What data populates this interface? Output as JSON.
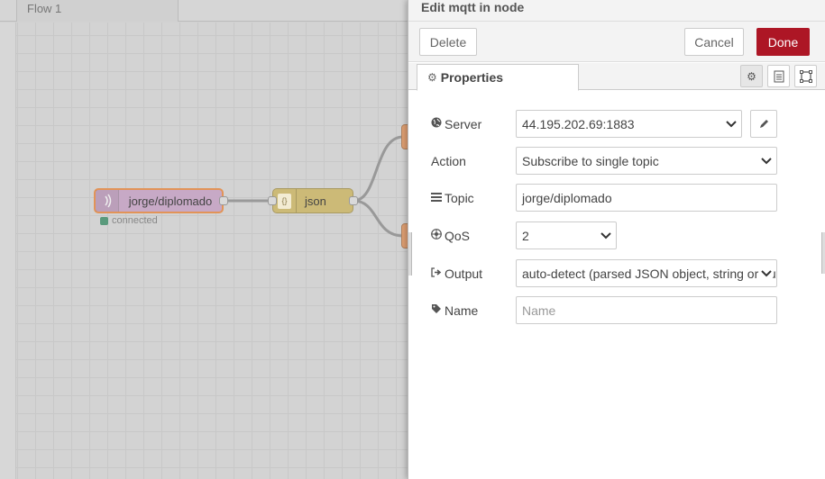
{
  "workspace": {
    "flow_tab": "Flow 1",
    "nodes": {
      "mqtt_in": {
        "label": "jorge/diplomado",
        "status": "connected"
      },
      "json": {
        "label": "json",
        "icon": "{}"
      }
    },
    "colors": {
      "mqtt_node": "#c7a9c6",
      "selected_border": "#e29458",
      "json_node": "#ccba77",
      "status_connected": "#5a9a7c"
    }
  },
  "tray": {
    "title": "Edit mqtt in node",
    "buttons": {
      "delete": "Delete",
      "cancel": "Cancel",
      "done": "Done"
    },
    "tabs": {
      "properties": "Properties"
    },
    "tab_icons": [
      "gear-icon",
      "description-icon",
      "appearance-icon"
    ],
    "fields": {
      "server": {
        "label": "Server",
        "value": "44.195.202.69:1883"
      },
      "action": {
        "label": "Action",
        "value": "Subscribe to single topic"
      },
      "topic": {
        "label": "Topic",
        "value": "jorge/diplomado"
      },
      "qos": {
        "label": "QoS",
        "value": "2"
      },
      "output": {
        "label": "Output",
        "value": "auto-detect (parsed JSON object, string or buf"
      },
      "name": {
        "label": "Name",
        "placeholder": "Name",
        "value": ""
      }
    },
    "colors": {
      "done_button": "#ad1625"
    }
  }
}
